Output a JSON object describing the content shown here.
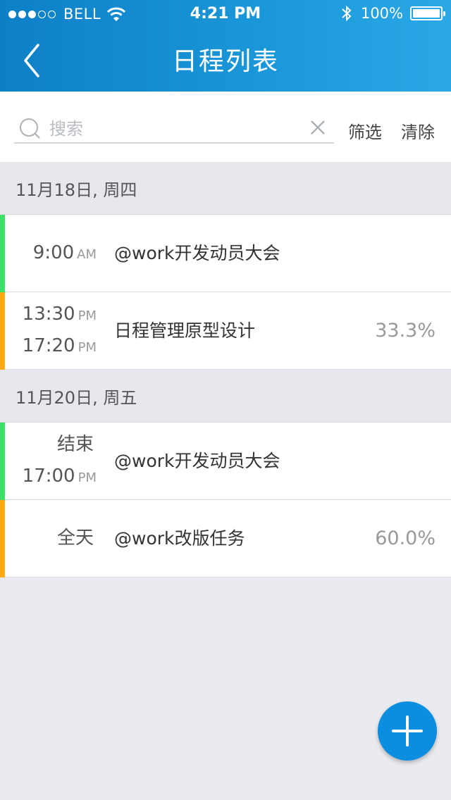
{
  "status_bar": {
    "carrier": "BELL",
    "time": "4:21 PM",
    "battery": "100%",
    "signal_bars": 3,
    "signal_total": 5
  },
  "nav": {
    "title": "日程列表",
    "back_icon": "chevron-left-icon"
  },
  "search": {
    "placeholder": "搜索",
    "value": "",
    "filter_label": "筛选",
    "reset_label": "清除"
  },
  "colors": {
    "header_start": "#0d7fc7",
    "header_end": "#2aa8e6",
    "green": "#3ee06a",
    "orange": "#ffa914",
    "fab": "#0c8ee0"
  },
  "sections": [
    {
      "date": "11月18日, 周四",
      "items": [
        {
          "time_lines": [
            {
              "time": "9:00",
              "ampm": "AM"
            }
          ],
          "title": "@work开发动员大会",
          "percent": "",
          "color": "green"
        },
        {
          "time_lines": [
            {
              "time": "13:30",
              "ampm": "PM"
            },
            {
              "time": "17:20",
              "ampm": "PM"
            }
          ],
          "title": "日程管理原型设计",
          "percent": "33.3%",
          "color": "orange"
        }
      ]
    },
    {
      "date": "11月20日, 周五",
      "items": [
        {
          "time_lines": [
            {
              "time": "结束",
              "ampm": ""
            },
            {
              "time": "17:00",
              "ampm": "PM"
            }
          ],
          "title": "@work开发动员大会",
          "percent": "",
          "color": "green"
        },
        {
          "time_lines": [
            {
              "time": "全天",
              "ampm": ""
            }
          ],
          "title": "@work改版任务",
          "percent": "60.0%",
          "color": "orange"
        }
      ]
    }
  ],
  "fab": {
    "icon": "plus-icon"
  }
}
